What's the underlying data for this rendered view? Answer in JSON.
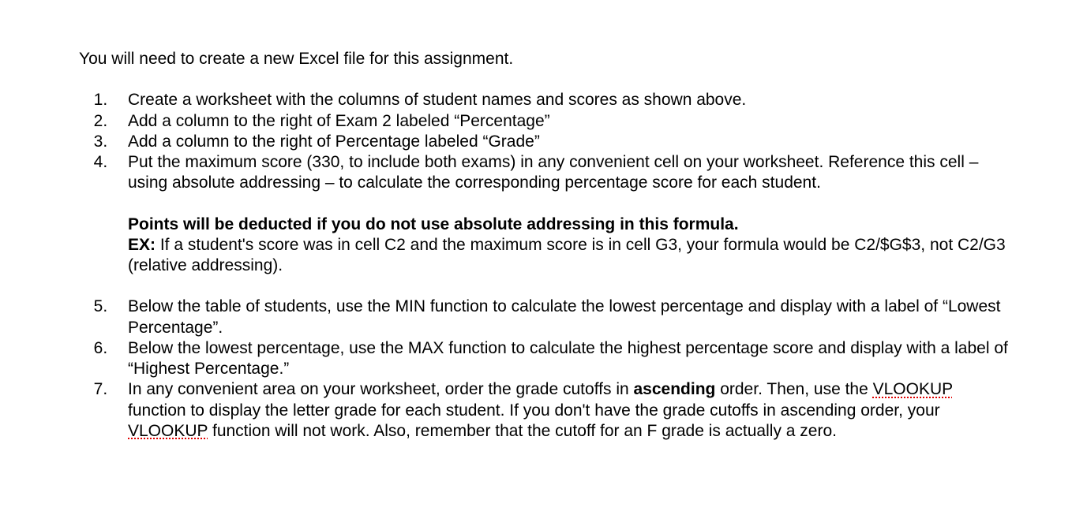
{
  "intro": "You will need to create a new Excel file for this assignment.",
  "items": {
    "i1": "Create a worksheet with the columns of student names and scores as shown above.",
    "i2": "Add a column to the right of Exam 2 labeled “Percentage”",
    "i3": "Add a column to the right of Percentage labeled “Grade”",
    "i4": "Put the maximum score (330, to include both exams) in any convenient cell on your worksheet. Reference this cell – using absolute addressing – to calculate the corresponding percentage score for each student.",
    "i4_note_bold": "Points will be deducted if you do not use absolute addressing in this formula.",
    "i4_ex_label": "EX:",
    "i4_ex_text": " If a student's score was in cell C2 and the maximum score is in cell G3, your formula would be C2/$G$3, not C2/G3 (relative addressing).",
    "i5": "Below the table of students, use the MIN function to calculate the lowest percentage and display with a label of “Lowest Percentage”.",
    "i6": "Below the lowest percentage, use the MAX function to calculate the highest percentage score and display with a label of “Highest Percentage.”",
    "i7_a": "In any convenient area on your worksheet, order the grade cutoffs in ",
    "i7_b_bold": "ascending",
    "i7_c": " order. Then, use the ",
    "i7_d_spell": "VLOOKUP",
    "i7_e": " function to display the letter grade for each student. If you don't have the grade cutoffs in ascending order, your ",
    "i7_f_spell": "VLOOKUP",
    "i7_g": " function will not work. Also, remember that the cutoff for an F grade is actually a zero."
  }
}
